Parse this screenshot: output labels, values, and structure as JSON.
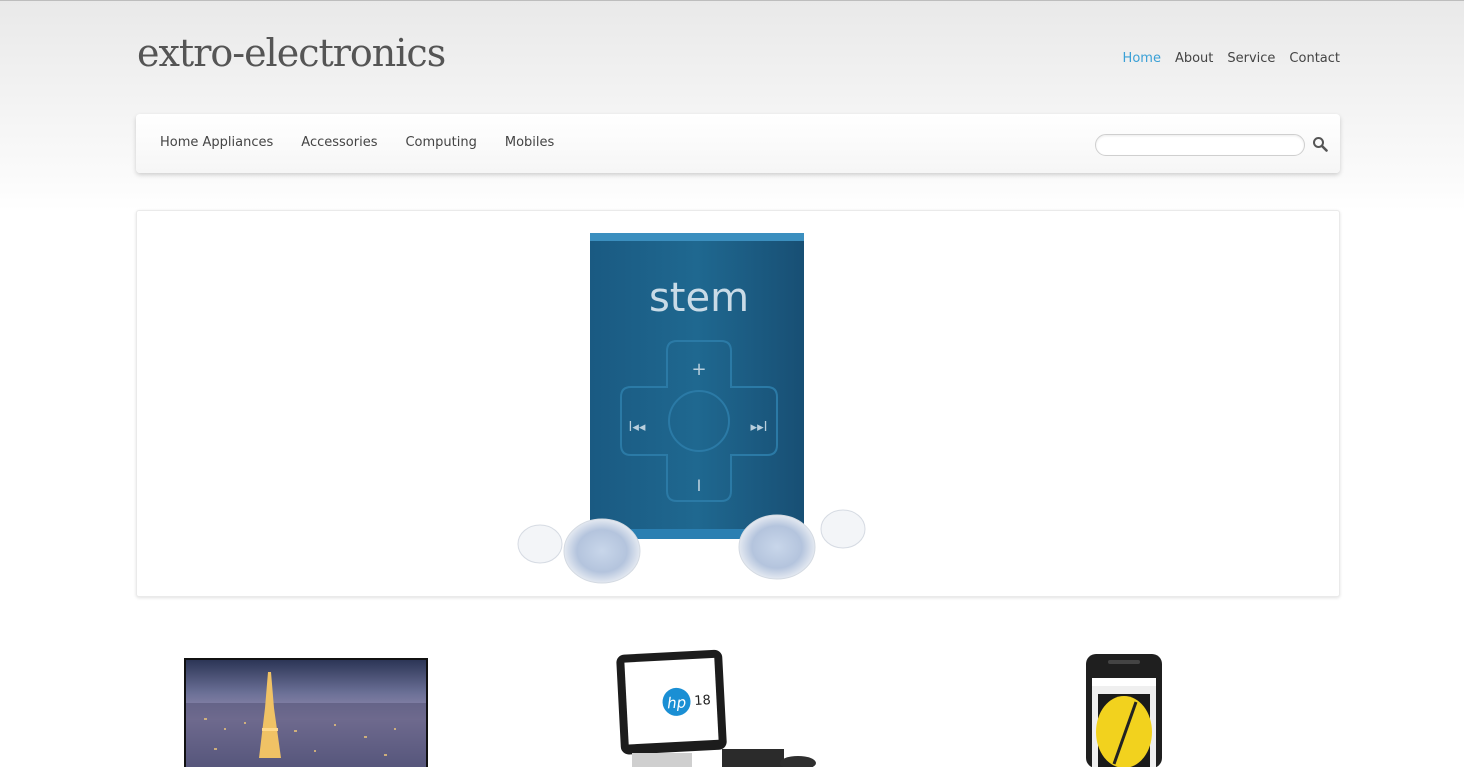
{
  "site": {
    "logo": "extro-electronics"
  },
  "top_nav": {
    "items": [
      {
        "label": "Home",
        "active": true
      },
      {
        "label": "About",
        "active": false
      },
      {
        "label": "Service",
        "active": false
      },
      {
        "label": "Contact",
        "active": false
      }
    ]
  },
  "menu": {
    "items": [
      "Home Appliances",
      "Accessories",
      "Computing",
      "Mobiles"
    ]
  },
  "search": {
    "value": "",
    "placeholder": ""
  },
  "slider": {
    "product_brand": "stem",
    "glyphs": {
      "plus": "+",
      "minus": "I",
      "prev": "I◂◂",
      "next": "▸▸I"
    }
  },
  "products": [
    {
      "name": "tv-thumbnail"
    },
    {
      "name": "all-in-one-pc-thumbnail",
      "badge": "18"
    },
    {
      "name": "smartphone-thumbnail"
    }
  ],
  "colors": {
    "accent": "#3aa0d6",
    "player_blue": "#1d5f87",
    "text": "#444444"
  }
}
